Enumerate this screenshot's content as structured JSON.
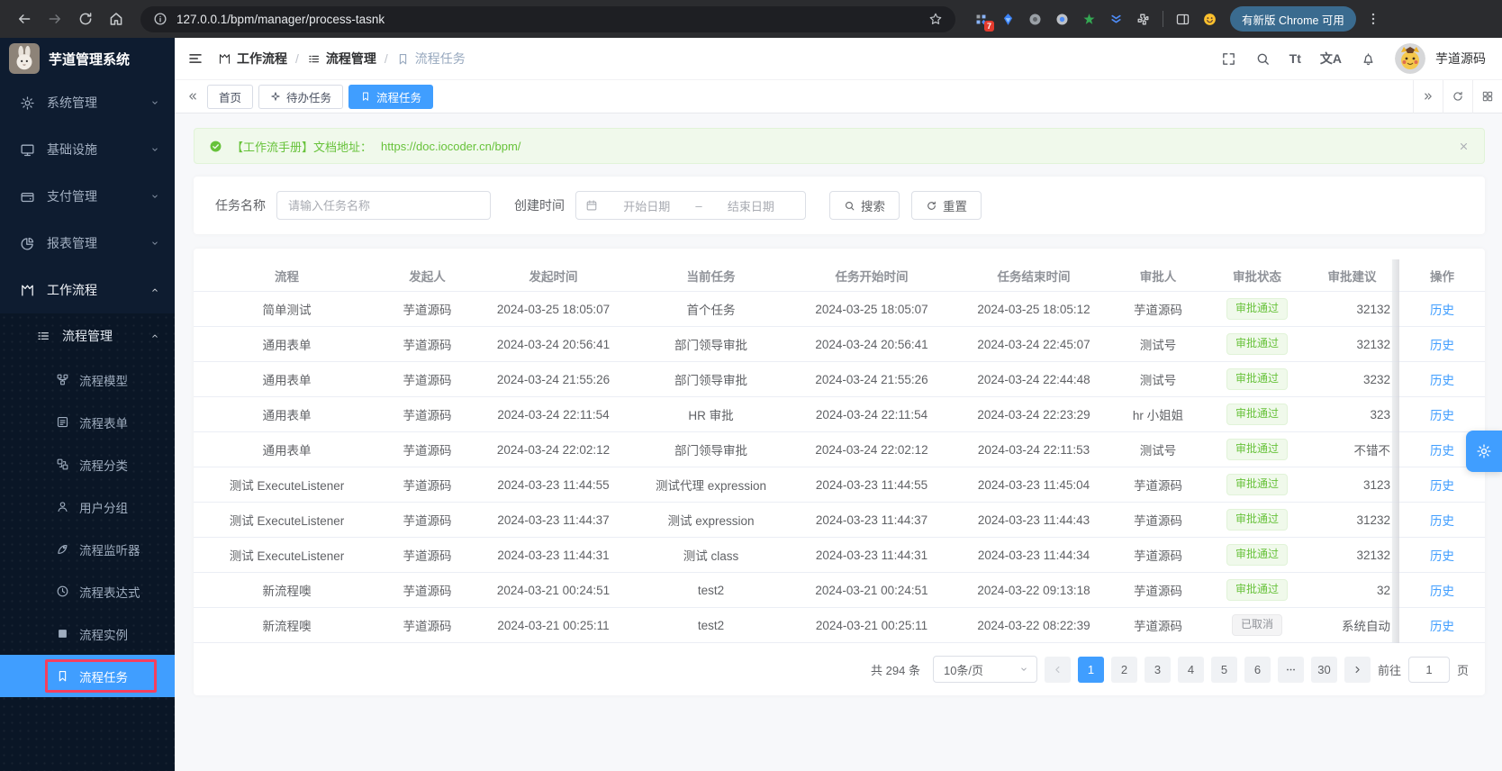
{
  "chrome": {
    "url": "127.0.0.1/bpm/manager/process-tasnk",
    "update_chip": "有新版 Chrome 可用",
    "extension_badge": "7"
  },
  "glyphs": {
    "font_size": "Tt",
    "translate": "文A"
  },
  "sidebar": {
    "logo_title": "芋道管理系统",
    "items": [
      {
        "label": "系统管理",
        "icon": "gear",
        "expanded": false
      },
      {
        "label": "基础设施",
        "icon": "monitor",
        "expanded": false
      },
      {
        "label": "支付管理",
        "icon": "wallet",
        "expanded": false
      },
      {
        "label": "报表管理",
        "icon": "pie",
        "expanded": false
      },
      {
        "label": "工作流程",
        "icon": "flow",
        "expanded": true
      }
    ],
    "group": {
      "label": "流程管理",
      "icon": "list",
      "children": [
        {
          "label": "流程模型",
          "icon": "nodes",
          "active": false
        },
        {
          "label": "流程表单",
          "icon": "form",
          "active": false
        },
        {
          "label": "流程分类",
          "icon": "category",
          "active": false
        },
        {
          "label": "用户分组",
          "icon": "user",
          "active": false
        },
        {
          "label": "流程监听器",
          "icon": "rocket",
          "active": false
        },
        {
          "label": "流程表达式",
          "icon": "clock",
          "active": false
        },
        {
          "label": "流程实例",
          "icon": "square-solid",
          "active": false
        },
        {
          "label": "流程任务",
          "icon": "bookmark",
          "active": true
        }
      ]
    }
  },
  "navbar": {
    "breadcrumb": [
      {
        "label": "工作流程",
        "icon": "flow"
      },
      {
        "label": "流程管理",
        "icon": "list"
      },
      {
        "label": "流程任务",
        "icon": "bookmark"
      }
    ],
    "username": "芋道源码"
  },
  "tabs": [
    {
      "label": "首页",
      "icon": null,
      "active": false
    },
    {
      "label": "待办任务",
      "icon": "sparkle",
      "active": false
    },
    {
      "label": "流程任务",
      "icon": "bookmark",
      "active": true
    }
  ],
  "alert": {
    "text": "【工作流手册】文档地址：",
    "link": "https://doc.iocoder.cn/bpm/"
  },
  "filters": {
    "task_name_label": "任务名称",
    "task_name_placeholder": "请输入任务名称",
    "create_time_label": "创建时间",
    "start_placeholder": "开始日期",
    "range_separator": "–",
    "end_placeholder": "结束日期",
    "search_label": "搜索",
    "reset_label": "重置"
  },
  "table": {
    "headers": [
      "流程",
      "发起人",
      "发起时间",
      "当前任务",
      "任务开始时间",
      "任务结束时间",
      "审批人",
      "审批状态",
      "审批建议",
      "操作"
    ],
    "action_label": "历史",
    "rows": [
      {
        "process": "简单测试",
        "starter": "芋道源码",
        "start": "2024-03-25 18:05:07",
        "task": "首个任务",
        "task_start": "2024-03-25 18:05:07",
        "task_end": "2024-03-25 18:05:12",
        "approver": "芋道源码",
        "status": "审批通过",
        "status_type": "success",
        "suggestion": "32132"
      },
      {
        "process": "通用表单",
        "starter": "芋道源码",
        "start": "2024-03-24 20:56:41",
        "task": "部门领导审批",
        "task_start": "2024-03-24 20:56:41",
        "task_end": "2024-03-24 22:45:07",
        "approver": "测试号",
        "status": "审批通过",
        "status_type": "success",
        "suggestion": "32132"
      },
      {
        "process": "通用表单",
        "starter": "芋道源码",
        "start": "2024-03-24 21:55:26",
        "task": "部门领导审批",
        "task_start": "2024-03-24 21:55:26",
        "task_end": "2024-03-24 22:44:48",
        "approver": "测试号",
        "status": "审批通过",
        "status_type": "success",
        "suggestion": "3232"
      },
      {
        "process": "通用表单",
        "starter": "芋道源码",
        "start": "2024-03-24 22:11:54",
        "task": "HR 审批",
        "task_start": "2024-03-24 22:11:54",
        "task_end": "2024-03-24 22:23:29",
        "approver": "hr 小姐姐",
        "status": "审批通过",
        "status_type": "success",
        "suggestion": "323"
      },
      {
        "process": "通用表单",
        "starter": "芋道源码",
        "start": "2024-03-24 22:02:12",
        "task": "部门领导审批",
        "task_start": "2024-03-24 22:02:12",
        "task_end": "2024-03-24 22:11:53",
        "approver": "测试号",
        "status": "审批通过",
        "status_type": "success",
        "suggestion": "不错不"
      },
      {
        "process": "测试 ExecuteListener",
        "starter": "芋道源码",
        "start": "2024-03-23 11:44:55",
        "task": "测试代理 expression",
        "task_start": "2024-03-23 11:44:55",
        "task_end": "2024-03-23 11:45:04",
        "approver": "芋道源码",
        "status": "审批通过",
        "status_type": "success",
        "suggestion": "3123"
      },
      {
        "process": "测试 ExecuteListener",
        "starter": "芋道源码",
        "start": "2024-03-23 11:44:37",
        "task": "测试 expression",
        "task_start": "2024-03-23 11:44:37",
        "task_end": "2024-03-23 11:44:43",
        "approver": "芋道源码",
        "status": "审批通过",
        "status_type": "success",
        "suggestion": "31232"
      },
      {
        "process": "测试 ExecuteListener",
        "starter": "芋道源码",
        "start": "2024-03-23 11:44:31",
        "task": "测试 class",
        "task_start": "2024-03-23 11:44:31",
        "task_end": "2024-03-23 11:44:34",
        "approver": "芋道源码",
        "status": "审批通过",
        "status_type": "success",
        "suggestion": "32132"
      },
      {
        "process": "新流程噢",
        "starter": "芋道源码",
        "start": "2024-03-21 00:24:51",
        "task": "test2",
        "task_start": "2024-03-21 00:24:51",
        "task_end": "2024-03-22 09:13:18",
        "approver": "芋道源码",
        "status": "审批通过",
        "status_type": "success",
        "suggestion": "32"
      },
      {
        "process": "新流程噢",
        "starter": "芋道源码",
        "start": "2024-03-21 00:25:11",
        "task": "test2",
        "task_start": "2024-03-21 00:25:11",
        "task_end": "2024-03-22 08:22:39",
        "approver": "芋道源码",
        "status": "已取消",
        "status_type": "info",
        "suggestion": "系统自动"
      }
    ]
  },
  "pagination": {
    "total": "共 294 条",
    "page_size": "10条/页",
    "pages": [
      "1",
      "2",
      "3",
      "4",
      "5",
      "6",
      "•••",
      "30"
    ],
    "active_page": "1",
    "goto_label": "前往",
    "goto_value": "1",
    "unit_label": "页"
  },
  "colors": {
    "accent": "#409eff",
    "success": "#67c23a",
    "sidebar": "#0e1c30",
    "highlight_box": "#f43f5e"
  }
}
